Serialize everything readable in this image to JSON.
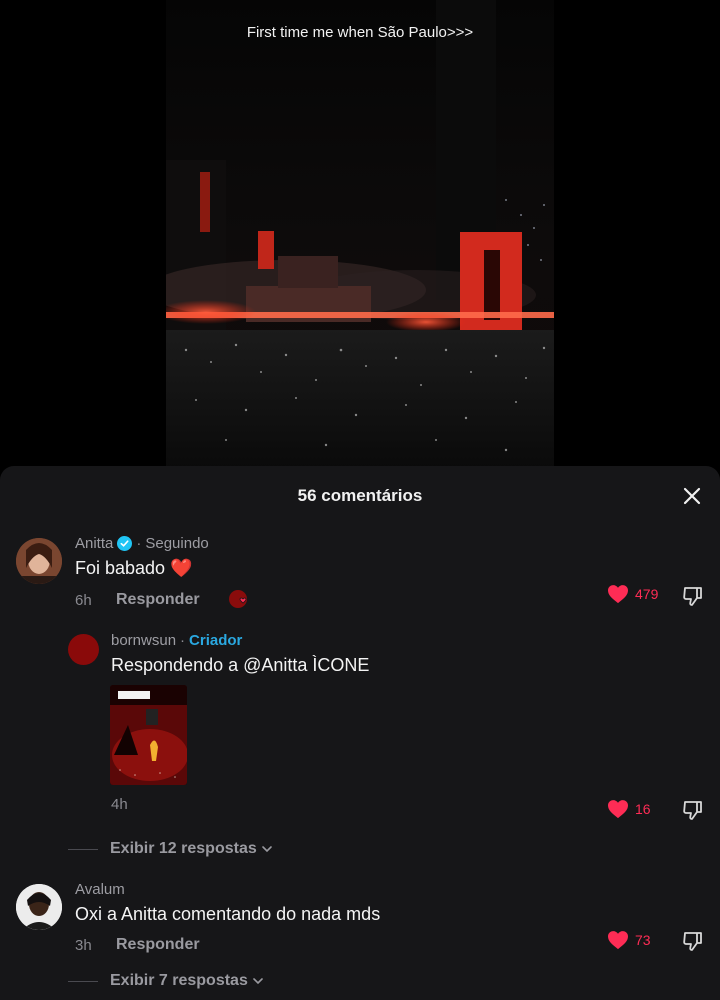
{
  "video": {
    "caption": "First time me when São Paulo>>>"
  },
  "comments_sheet": {
    "title": "56 comentários",
    "comments": [
      {
        "username": "Anitta",
        "verified": true,
        "relation": "Seguindo",
        "text": "Foi babado ❤️",
        "time": "6h",
        "reply_label": "Responder",
        "likes": "479",
        "liked_by_creator": true
      },
      {
        "username": "bornwsun",
        "role": "Criador",
        "text": "Respondendo a @Anitta ÌCONE",
        "time": "4h",
        "likes": "16",
        "has_video_reply": true
      },
      {
        "username": "Avalum",
        "text": "Oxi a Anitta comentando do nada mds",
        "time": "3h",
        "reply_label": "Responder",
        "likes": "73"
      }
    ],
    "view_replies": [
      {
        "label": "Exibir 12 respostas"
      },
      {
        "label": "Exibir 7 respostas"
      }
    ]
  },
  "colors": {
    "like": "#fe2c55",
    "verified": "#20c5f5",
    "creator_tag": "#2aa8e0",
    "sheet_bg": "#161618"
  },
  "icons": [
    "close-icon",
    "verified-icon",
    "heart-icon",
    "dislike-icon",
    "chevron-down-icon"
  ]
}
